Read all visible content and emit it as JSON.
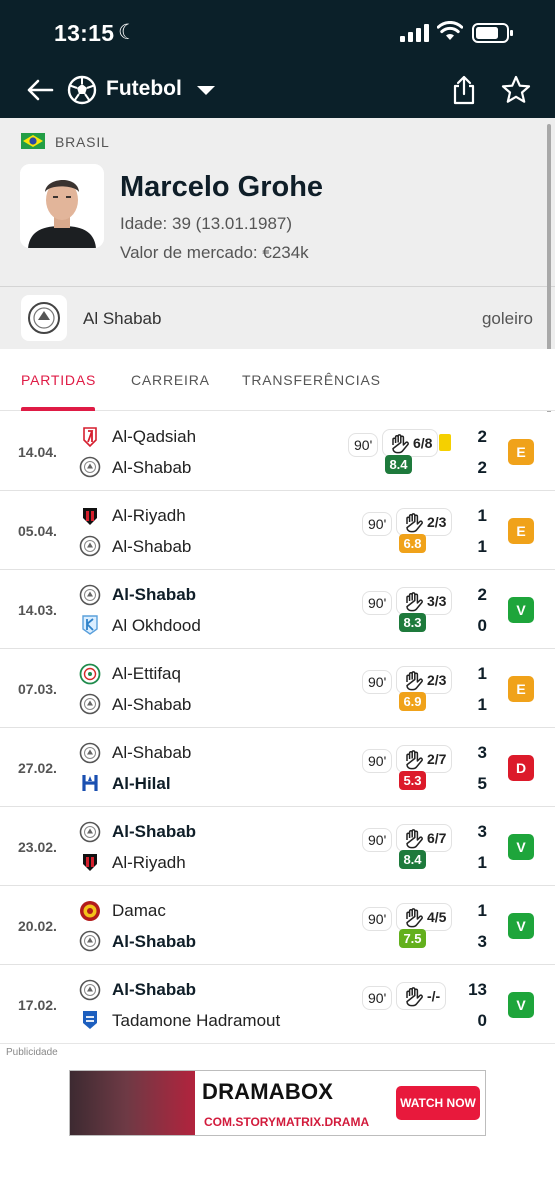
{
  "status_bar": {
    "time": "13:15"
  },
  "header": {
    "sport": "Futebol"
  },
  "player": {
    "country": "BRASIL",
    "name": "Marcelo Grohe",
    "age": "Idade: 39 (13.01.1987)",
    "market_value": "Valor de mercado: €234k",
    "team": "Al Shabab",
    "position": "goleiro"
  },
  "tabs": [
    {
      "label": "PARTIDAS",
      "active": true
    },
    {
      "label": "CARREIRA",
      "active": false
    },
    {
      "label": "TRANSFERÊNCIAS",
      "active": false
    }
  ],
  "matches": [
    {
      "date": "14.04.",
      "home": "Al-Qadsiah",
      "away": "Al-Shabab",
      "home_bold": false,
      "away_bold": false,
      "minutes": "90'",
      "saves": "6/8",
      "yellow_card": true,
      "rating": "8.4",
      "rating_color": "#1e7a3c",
      "home_score": "2",
      "away_score": "2",
      "result": "E",
      "result_color": "#f0a21a"
    },
    {
      "date": "05.04.",
      "home": "Al-Riyadh",
      "away": "Al-Shabab",
      "home_bold": false,
      "away_bold": false,
      "minutes": "90'",
      "saves": "2/3",
      "yellow_card": false,
      "rating": "6.8",
      "rating_color": "#f0a21a",
      "home_score": "1",
      "away_score": "1",
      "result": "E",
      "result_color": "#f0a21a"
    },
    {
      "date": "14.03.",
      "home": "Al-Shabab",
      "away": "Al Okhdood",
      "home_bold": true,
      "away_bold": false,
      "minutes": "90'",
      "saves": "3/3",
      "yellow_card": false,
      "rating": "8.3",
      "rating_color": "#1e7a3c",
      "home_score": "2",
      "away_score": "0",
      "result": "V",
      "result_color": "#1ea53b"
    },
    {
      "date": "07.03.",
      "home": "Al-Ettifaq",
      "away": "Al-Shabab",
      "home_bold": false,
      "away_bold": false,
      "minutes": "90'",
      "saves": "2/3",
      "yellow_card": false,
      "rating": "6.9",
      "rating_color": "#f0a21a",
      "home_score": "1",
      "away_score": "1",
      "result": "E",
      "result_color": "#f0a21a"
    },
    {
      "date": "27.02.",
      "home": "Al-Shabab",
      "away": "Al-Hilal",
      "home_bold": false,
      "away_bold": true,
      "minutes": "90'",
      "saves": "2/7",
      "yellow_card": false,
      "rating": "5.3",
      "rating_color": "#dc1a2a",
      "home_score": "3",
      "away_score": "5",
      "result": "D",
      "result_color": "#dc1a2a"
    },
    {
      "date": "23.02.",
      "home": "Al-Shabab",
      "away": "Al-Riyadh",
      "home_bold": true,
      "away_bold": false,
      "minutes": "90'",
      "saves": "6/7",
      "yellow_card": false,
      "rating": "8.4",
      "rating_color": "#1e7a3c",
      "home_score": "3",
      "away_score": "1",
      "result": "V",
      "result_color": "#1ea53b"
    },
    {
      "date": "20.02.",
      "home": "Damac",
      "away": "Al-Shabab",
      "home_bold": false,
      "away_bold": true,
      "minutes": "90'",
      "saves": "4/5",
      "yellow_card": false,
      "rating": "7.5",
      "rating_color": "#63b01d",
      "home_score": "1",
      "away_score": "3",
      "result": "V",
      "result_color": "#1ea53b"
    },
    {
      "date": "17.02.",
      "home": "Al-Shabab",
      "away": "Tadamone Hadramout",
      "home_bold": true,
      "away_bold": false,
      "minutes": "90'",
      "saves": "-/-",
      "yellow_card": false,
      "rating": "",
      "rating_color": "",
      "home_score": "13",
      "away_score": "0",
      "result": "V",
      "result_color": "#1ea53b"
    }
  ],
  "ad": {
    "label": "Publicidade",
    "brand": "DRAMABOX",
    "domain": "COM.STORYMATRIX.DRAMA",
    "cta": "WATCH NOW"
  }
}
